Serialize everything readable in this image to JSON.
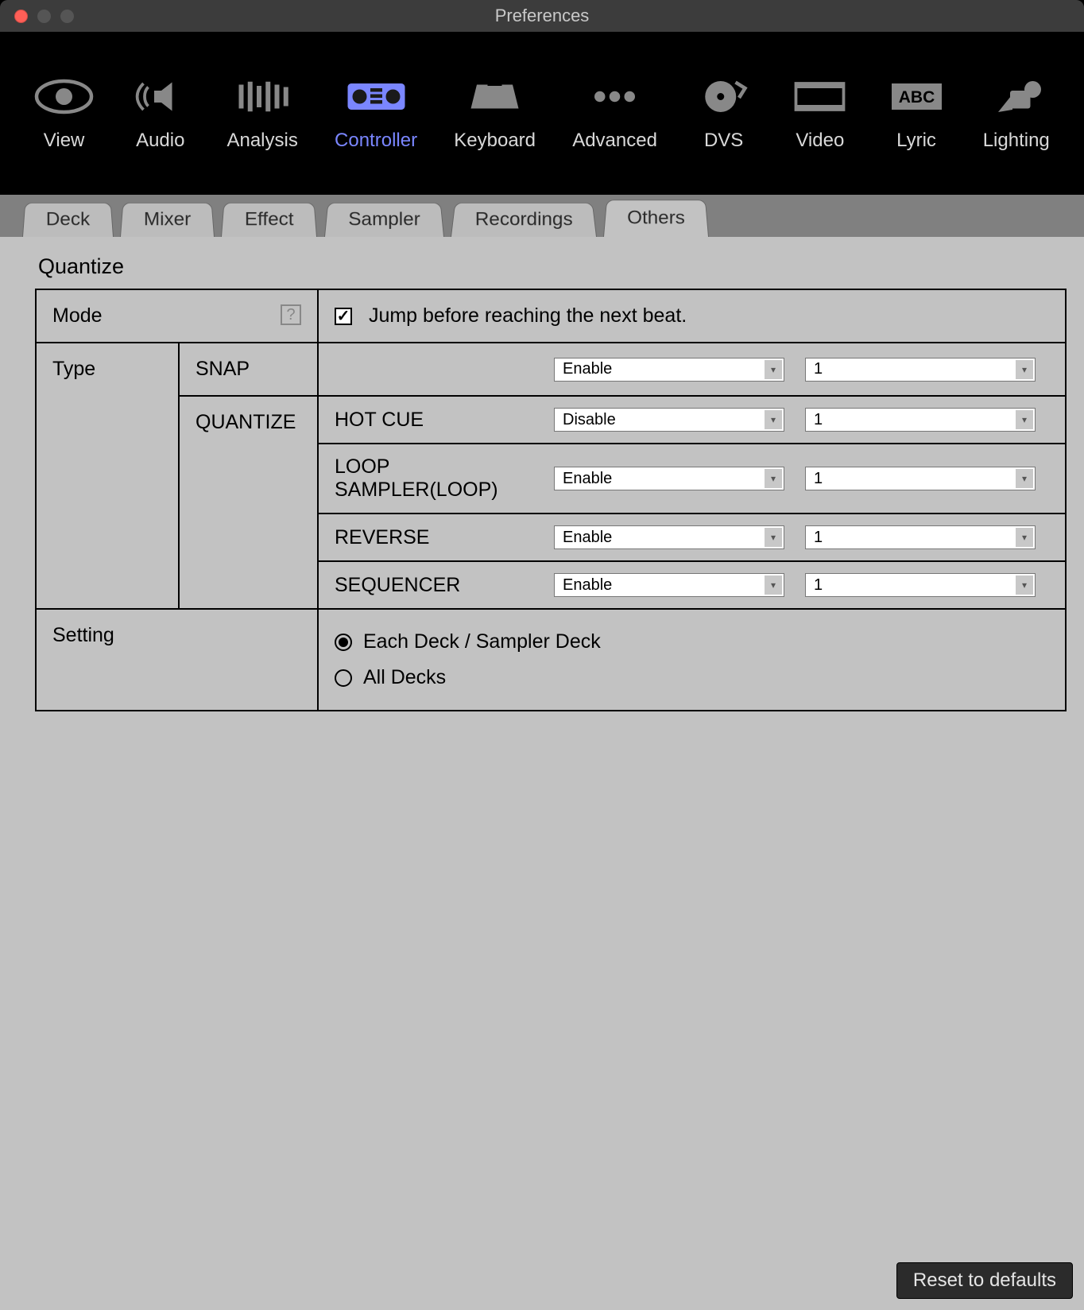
{
  "window": {
    "title": "Preferences"
  },
  "toolbar": {
    "items": [
      {
        "label": "View"
      },
      {
        "label": "Audio"
      },
      {
        "label": "Analysis"
      },
      {
        "label": "Controller"
      },
      {
        "label": "Keyboard"
      },
      {
        "label": "Advanced"
      },
      {
        "label": "DVS"
      },
      {
        "label": "Video"
      },
      {
        "label": "Lyric"
      },
      {
        "label": "Lighting"
      }
    ],
    "active_index": 3
  },
  "tabs": {
    "items": [
      "Deck",
      "Mixer",
      "Effect",
      "Sampler",
      "Recordings",
      "Others"
    ],
    "active_index": 5
  },
  "quantize": {
    "section_title": "Quantize",
    "mode_label": "Mode",
    "mode_checkbox_label": "Jump before reaching the next beat.",
    "mode_checked": true,
    "type_label": "Type",
    "snap_label": "SNAP",
    "snap": {
      "enable": "Enable",
      "value": "1"
    },
    "quantize_label": "QUANTIZE",
    "features": [
      {
        "name": "HOT CUE",
        "enable": "Disable",
        "value": "1"
      },
      {
        "name": "LOOP SAMPLER(LOOP)",
        "enable": "Enable",
        "value": "1"
      },
      {
        "name": "REVERSE",
        "enable": "Enable",
        "value": "1"
      },
      {
        "name": "SEQUENCER",
        "enable": "Enable",
        "value": "1"
      }
    ],
    "setting_label": "Setting",
    "setting_options": [
      {
        "label": "Each Deck / Sampler Deck",
        "checked": true
      },
      {
        "label": "All Decks",
        "checked": false
      }
    ]
  },
  "footer": {
    "reset_label": "Reset to defaults"
  },
  "help_glyph": "?"
}
